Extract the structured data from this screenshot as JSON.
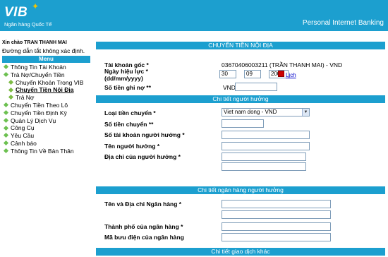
{
  "header": {
    "logo": "VIB",
    "logo_sub": "Ngân hàng Quốc Tế",
    "title": "Personal Internet Banking"
  },
  "sidebar": {
    "greeting": "Xin chào TRAN THANH MAI",
    "note": "Đường dẫn tắt không xác định.",
    "menu_title": "Menu",
    "items": [
      {
        "label": "Thông Tin Tài Khoản",
        "level": 1
      },
      {
        "label": "Trả Nợ/Chuyển Tiền",
        "level": 1
      },
      {
        "label": "Chuyển Khoản Trong VIB",
        "level": 2
      },
      {
        "label": "Chuyển Tiền Nội Địa",
        "level": 2,
        "active": true
      },
      {
        "label": "Trả Nợ",
        "level": 2
      },
      {
        "label": "Chuyển Tiền Theo Lô",
        "level": 1
      },
      {
        "label": "Chuyển Tiền Định Kỳ",
        "level": 1
      },
      {
        "label": "Quản Lý Dịch Vụ",
        "level": 1
      },
      {
        "label": "Công Cụ",
        "level": 1
      },
      {
        "label": "Yêu Cầu",
        "level": 1
      },
      {
        "label": "Cảnh báo",
        "level": 1
      },
      {
        "label": "Thông Tin Về Bản Thân",
        "level": 1
      }
    ]
  },
  "main": {
    "title_bar": "CHUYỂN TIỀN NỘI ĐỊA",
    "source_account_label": "Tài khoản gốc *",
    "source_account_value": "03670406003211 (TRẦN THANH MAI) - VND",
    "effective_date_label": "Ngày hiệu lực *",
    "effective_date_format": "(dd/mm/yyyy)",
    "date_day": "30",
    "date_month": "09",
    "date_year": "2009",
    "calendar_link": "Lịch",
    "debit_amount_label": "Số tiền ghi nợ **",
    "debit_currency": "VND",
    "beneficiary_section": "Chi tiết người hưởng",
    "transfer_type_label": "Loại tiền chuyển *",
    "transfer_type_value": "Viet nam dong - VND",
    "transfer_amount_label": "Số tiền chuyển **",
    "beneficiary_account_label": "Số tài khoản người hưởng *",
    "beneficiary_name_label": "Tên người hưởng *",
    "beneficiary_address_label": "Địa chỉ của người hưởng *",
    "bank_section": "Chi tiết ngân hàng người hưởng",
    "bank_name_label": "Tên và Địa chỉ Ngân hàng *",
    "bank_city_label": "Thành phố của ngân hàng *",
    "bank_postal_label": "Mã bưu điện của ngân hàng",
    "other_section": "Chi tiết giao dịch khác"
  }
}
